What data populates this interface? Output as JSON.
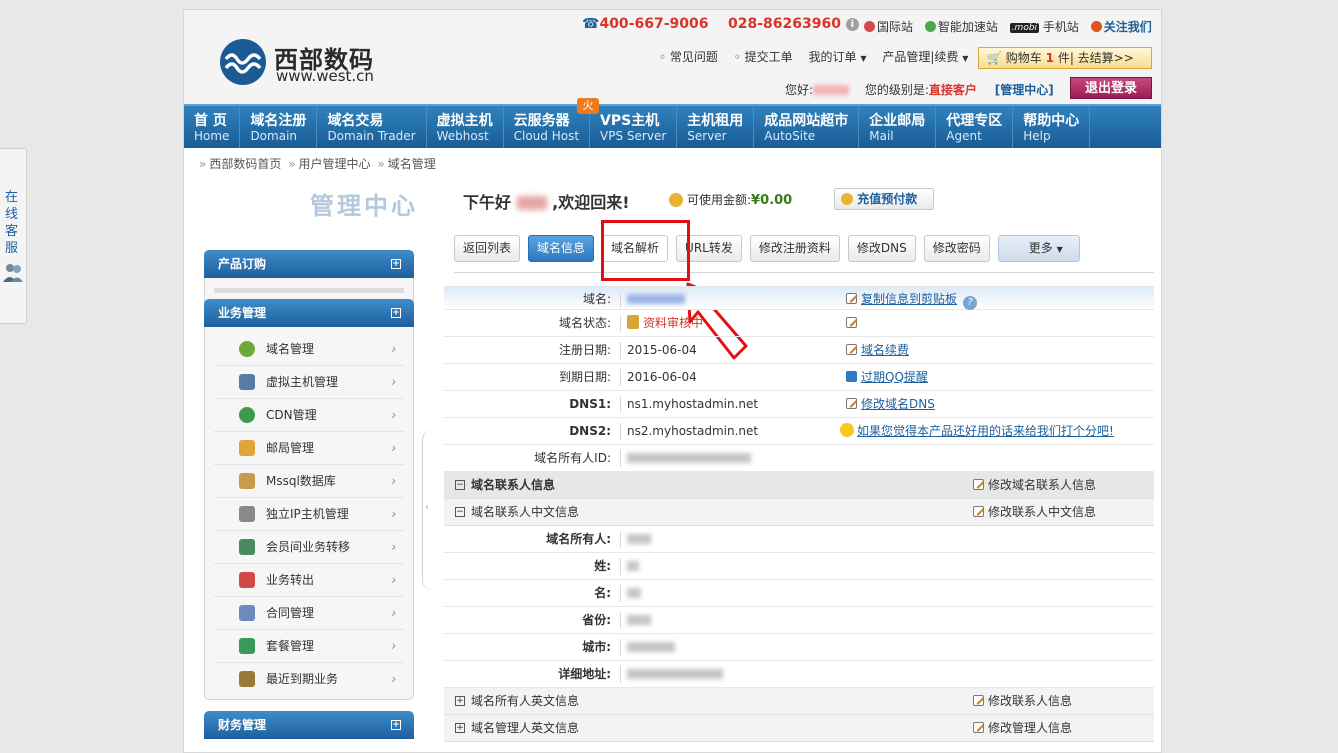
{
  "float_service": {
    "label": "在线客服"
  },
  "header": {
    "logo_cn": "西部数码",
    "logo_en": "www.west.cn",
    "hotline1": "400-667-9006",
    "hotline2": "028-86263960",
    "top_links": [
      "国际站",
      "智能加速站",
      "手机站",
      "关注我们"
    ],
    "mobi_badge": ".mobi",
    "sub_links": [
      "常见问题",
      "提交工单",
      "我的订单",
      "产品管理|续费"
    ],
    "cart_prefix": "购物车",
    "cart_count": "1",
    "cart_suffix": "件| 去结算>>",
    "greeting": "您好:",
    "level_label": "您的级别是:",
    "level_value": "直接客户",
    "manage_center": "[管理中心]",
    "logout": "退出登录"
  },
  "main_nav": [
    {
      "cn": "首 页",
      "en": "Home"
    },
    {
      "cn": "域名注册",
      "en": "Domain"
    },
    {
      "cn": "域名交易",
      "en": "Domain Trader"
    },
    {
      "cn": "虚拟主机",
      "en": "Webhost"
    },
    {
      "cn": "云服务器",
      "en": "Cloud Host"
    },
    {
      "cn": "VPS主机",
      "en": "VPS Server"
    },
    {
      "cn": "主机租用",
      "en": "Server"
    },
    {
      "cn": "成品网站超市",
      "en": "AutoSite"
    },
    {
      "cn": "企业邮局",
      "en": "Mail"
    },
    {
      "cn": "代理专区",
      "en": "Agent"
    },
    {
      "cn": "帮助中心",
      "en": "Help"
    }
  ],
  "hot_badge": "火",
  "breadcrumb": [
    "西部数码首页",
    "用户管理中心",
    "域名管理"
  ],
  "sidebar": {
    "title": "管理中心",
    "groups": [
      "产品订购",
      "业务管理",
      "财务管理"
    ],
    "items": [
      {
        "label": "域名管理",
        "icon": "globe-icon",
        "color": "#6fa83a"
      },
      {
        "label": "虚拟主机管理",
        "icon": "server-icon",
        "color": "#5a7aa8"
      },
      {
        "label": "CDN管理",
        "icon": "cdn-icon",
        "color": "#3e9a4c"
      },
      {
        "label": "邮局管理",
        "icon": "mail-icon",
        "color": "#e0a43a"
      },
      {
        "label": "Mssql数据库",
        "icon": "database-icon",
        "color": "#c99b4e"
      },
      {
        "label": "独立IP主机管理",
        "icon": "ip-host-icon",
        "color": "#8a8a8a"
      },
      {
        "label": "会员间业务转移",
        "icon": "transfer-icon",
        "color": "#4a8a5c"
      },
      {
        "label": "业务转出",
        "icon": "export-icon",
        "color": "#d04a4a"
      },
      {
        "label": "合同管理",
        "icon": "contract-icon",
        "color": "#6a8ac0"
      },
      {
        "label": "套餐管理",
        "icon": "package-icon",
        "color": "#3a9a5a"
      },
      {
        "label": "最近到期业务",
        "icon": "expire-icon",
        "color": "#9a7a3a"
      }
    ]
  },
  "welcome": {
    "prefix": "下午好",
    "suffix": ",欢迎回来!"
  },
  "balance": {
    "label": "可使用金额:",
    "amount": "¥0.00"
  },
  "recharge": "充值预付款",
  "tabs": [
    "返回列表",
    "域名信息",
    "域名解析",
    "URL转发",
    "修改注册资料",
    "修改DNS",
    "修改密码",
    "更多"
  ],
  "domain_info": {
    "rows": [
      {
        "label": "域名:",
        "value": "",
        "action": "复制信息到剪贴板"
      },
      {
        "label": "域名状态:",
        "value": "资料审核中",
        "action": ""
      },
      {
        "label": "注册日期:",
        "value": "2015-06-04",
        "action": "域名续费"
      },
      {
        "label": "到期日期:",
        "value": "2016-06-04",
        "action": "过期QQ提醒"
      },
      {
        "label": "DNS1:",
        "value": "ns1.myhostadmin.net",
        "action": "修改域名DNS"
      },
      {
        "label": "DNS2:",
        "value": "ns2.myhostadmin.net",
        "action": "如果您觉得本产品还好用的话来给我们打个分吧!"
      },
      {
        "label": "域名所有人ID:",
        "value": "",
        "action": ""
      }
    ],
    "sections": [
      {
        "title": "域名联系人信息",
        "right": "修改域名联系人信息",
        "toggle": "−"
      },
      {
        "title": "域名联系人中文信息",
        "right": "修改联系人中文信息",
        "toggle": "−"
      }
    ],
    "contact_rows": [
      "域名所有人:",
      "姓:",
      "名:",
      "省份:",
      "城市:",
      "详细地址:"
    ],
    "bottom_sections": [
      {
        "title": "域名所有人英文信息",
        "right": "修改联系人信息",
        "toggle": "+"
      },
      {
        "title": "域名管理人英文信息",
        "right": "修改管理人信息",
        "toggle": "+"
      }
    ]
  }
}
